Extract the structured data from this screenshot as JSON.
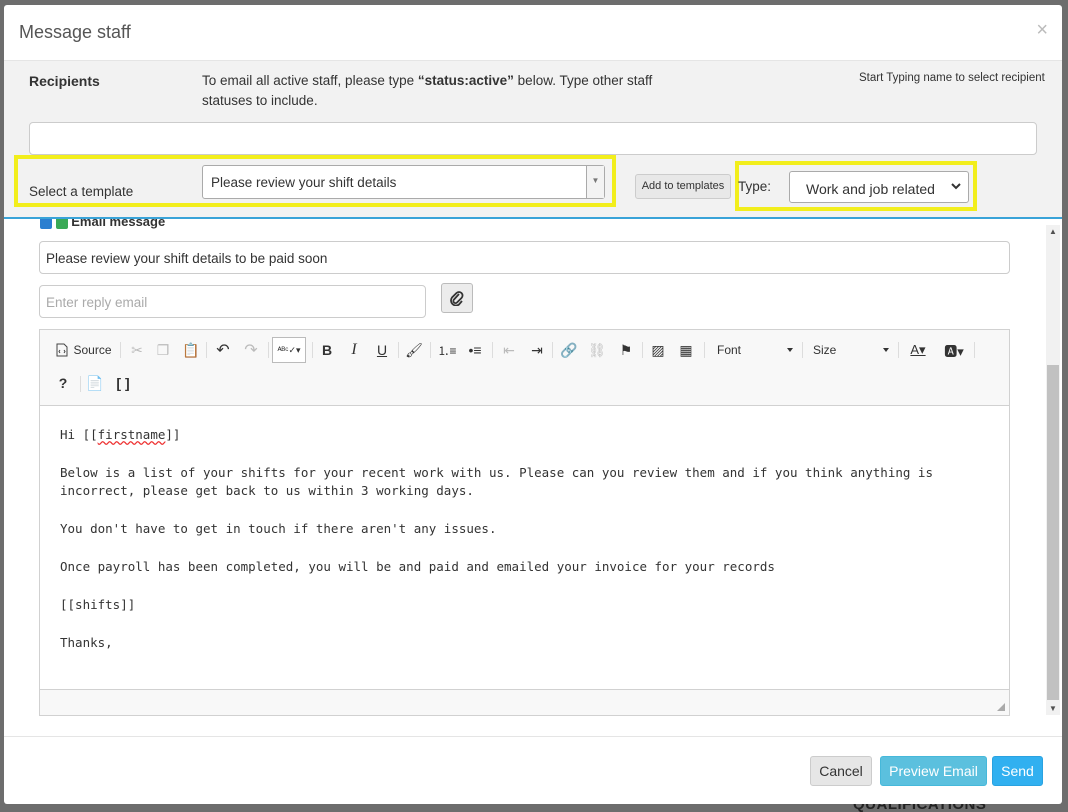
{
  "background": {
    "partial_text": "QUALIFICATIONS"
  },
  "modal": {
    "title": "Message staff",
    "close": "×"
  },
  "recipients": {
    "label": "Recipients",
    "help_prefix": "To email all active staff, please type ",
    "help_bold": "“status:active”",
    "help_suffix": " below. Type other staff statuses to include.",
    "hint": "Start Typing name to select recipient",
    "value": ""
  },
  "template": {
    "label": "Select a template",
    "selected": "Please review your shift details",
    "add_button": "Add to templates"
  },
  "type": {
    "label": "Type:",
    "selected": "Work and job related"
  },
  "email": {
    "label": "Email message",
    "subject": "Please review your shift details to be paid soon",
    "reply_placeholder": "Enter reply email"
  },
  "toolbar": {
    "source_label": "Source",
    "font_label": "Font",
    "size_label": "Size"
  },
  "body": {
    "greeting_prefix": "Hi [[",
    "greeting_token": "firstname",
    "greeting_suffix": "]]",
    "para1": "Below is a list of your shifts for your recent work with us. Please can you review them and if you think anything is incorrect, please get back to us within 3 working days.",
    "para2": "You don't have to get in touch if there aren't any issues.",
    "para3": "Once payroll has been completed, you will be and paid and emailed your invoice for your records",
    "para4": "[[shifts]]",
    "para5": "Thanks,"
  },
  "footer": {
    "cancel": "Cancel",
    "preview": "Preview Email",
    "send": "Send"
  },
  "colors": {
    "highlight": "#f2ee1c",
    "primary": "#31b0f0",
    "info": "#5bc0de",
    "accent_line": "#39a3d8"
  }
}
